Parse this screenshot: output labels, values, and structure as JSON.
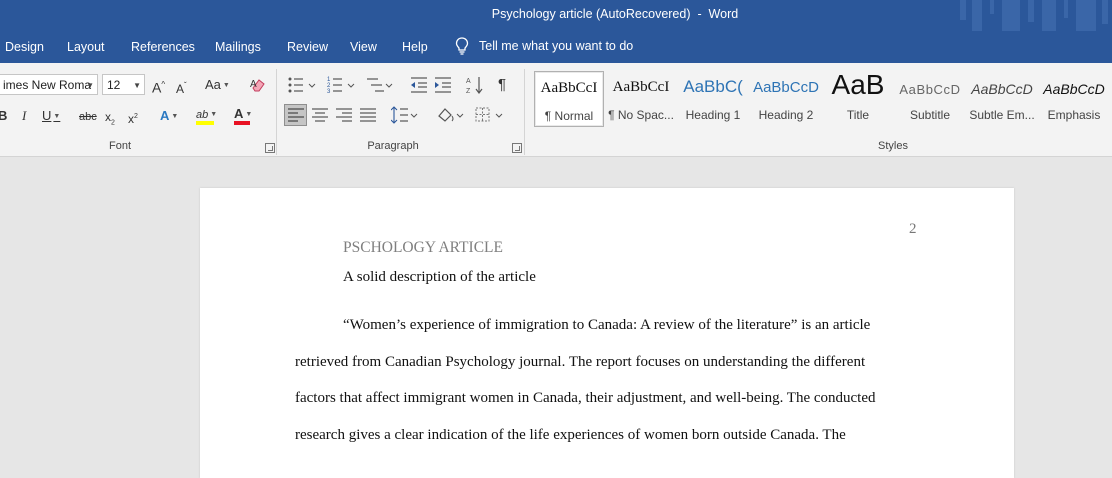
{
  "window": {
    "title": "Psychology article (AutoRecovered)  -  Word"
  },
  "tabs": [
    {
      "label": "Design"
    },
    {
      "label": "Layout"
    },
    {
      "label": "References"
    },
    {
      "label": "Mailings"
    },
    {
      "label": "Review"
    },
    {
      "label": "View"
    },
    {
      "label": "Help"
    }
  ],
  "tell_me": {
    "placeholder": "Tell me what you want to do",
    "icon": "lightbulb-icon"
  },
  "font_group": {
    "label": "Font",
    "font_name": "imes New Roma",
    "font_size": "12",
    "change_case": "Aa"
  },
  "paragraph_group": {
    "label": "Paragraph"
  },
  "styles_group": {
    "label": "Styles",
    "items": [
      {
        "preview": "AaBbCcI",
        "name": "¶ Normal",
        "selected": true
      },
      {
        "preview": "AaBbCcI",
        "name": "¶ No Spac..."
      },
      {
        "preview": "AaBbC(",
        "name": "Heading 1"
      },
      {
        "preview": "AaBbCcD",
        "name": "Heading 2"
      },
      {
        "preview": "AaB",
        "name": "Title"
      },
      {
        "preview": "AaBbCcD",
        "name": "Subtitle"
      },
      {
        "preview": "AaBbCcD",
        "name": "Subtle Em..."
      },
      {
        "preview": "AaBbCcD",
        "name": "Emphasis"
      }
    ]
  },
  "colors": {
    "accent": "#2b579a",
    "highlight": "#ffff00",
    "font_color": "#e81123"
  },
  "document": {
    "page_number": "2",
    "running_head": "PSCHOLOGY ARTICLE",
    "heading": "A solid description of the article",
    "paragraph_lines": [
      "“Women’s experience of immigration to Canada: A review of the literature” is an article",
      "retrieved from Canadian Psychology journal. The report focuses on understanding the different",
      "factors that affect immigrant women in Canada, their adjustment, and well-being. The conducted",
      "research gives a clear indication of the life experiences of women born outside Canada. The"
    ]
  }
}
